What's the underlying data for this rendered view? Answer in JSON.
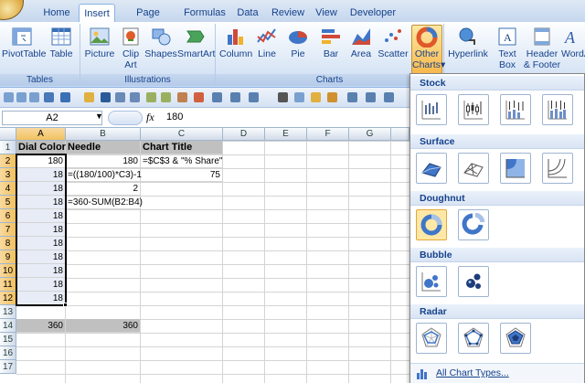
{
  "tabs": [
    "Home",
    "Insert",
    "Page Layout",
    "Formulas",
    "Data",
    "Review",
    "View",
    "Developer"
  ],
  "active_tab": "Insert",
  "ribbon": {
    "tables_group": "Tables",
    "illustrations_group": "Illustrations",
    "charts_group": "Charts",
    "pivot": "PivotTable",
    "table": "Table",
    "picture": "Picture",
    "clipart_1": "Clip",
    "clipart_2": "Art",
    "shapes": "Shapes",
    "smartart": "SmartArt",
    "column": "Column",
    "line": "Line",
    "pie": "Pie",
    "bar": "Bar",
    "area": "Area",
    "scatter": "Scatter",
    "other_1": "Other",
    "other_2": "Charts",
    "hyperlink": "Hyperlink",
    "textbox_1": "Text",
    "textbox_2": "Box",
    "header_1": "Header",
    "header_2": "& Footer",
    "wordart": "WordA"
  },
  "formula_bar": {
    "name_box": "A2",
    "fx": "fx",
    "value": "180"
  },
  "columns": [
    "A",
    "B",
    "C",
    "D",
    "E",
    "F",
    "G"
  ],
  "rows": [
    "1",
    "2",
    "3",
    "4",
    "5",
    "6",
    "7",
    "8",
    "9",
    "10",
    "11",
    "12",
    "13",
    "14",
    "15",
    "16",
    "17"
  ],
  "cells": {
    "A1": "Dial Colors",
    "B1": "Needle",
    "C1": "Chart Title",
    "A2": "180",
    "B2": "180",
    "C2": "=$C$3 & \"% Share\"",
    "A3": "18",
    "B3": "=((180/100)*C3)-1",
    "C3": "75",
    "A4": "18",
    "B4": "2",
    "A5": "18",
    "B5": "=360-SUM(B2:B4)",
    "A6": "18",
    "A7": "18",
    "A8": "18",
    "A9": "18",
    "A10": "18",
    "A11": "18",
    "A12": "18",
    "A14": "360",
    "B14": "360"
  },
  "dropdown": {
    "stock": "Stock",
    "surface": "Surface",
    "doughnut": "Doughnut",
    "bubble": "Bubble",
    "radar": "Radar",
    "all": "All Chart Types..."
  },
  "colors": {
    "accent": "#15428b",
    "selection": "#f1c15f",
    "header_fill": "#c0c0c0"
  }
}
